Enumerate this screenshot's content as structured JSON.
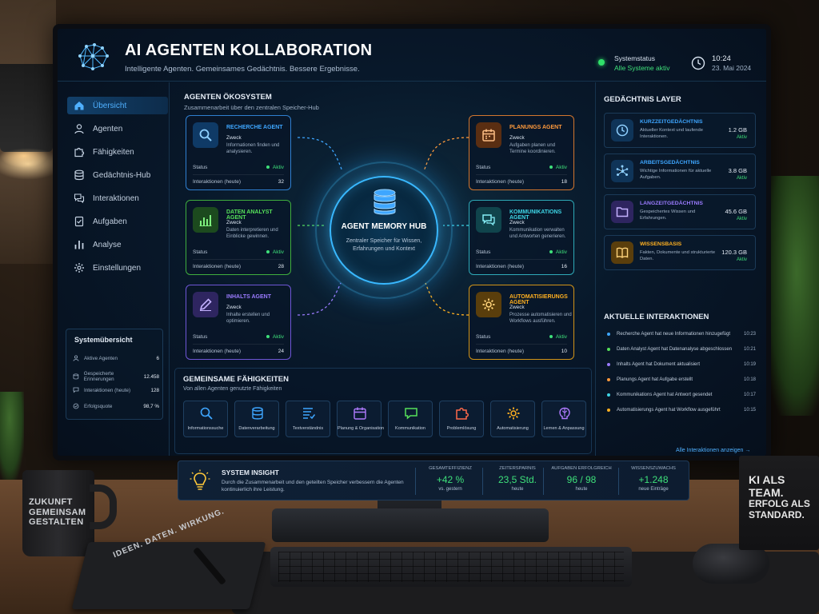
{
  "header": {
    "title": "AI AGENTEN KOLLABORATION",
    "subtitle": "Intelligente Agenten. Gemeinsames Gedächtnis. Bessere Ergebnisse.",
    "status_label": "Systemstatus",
    "status_value": "Alle Systeme aktiv",
    "time": "10:24",
    "date": "23. Mai 2024"
  },
  "sidebar": {
    "items": [
      {
        "label": "Übersicht",
        "icon": "home-icon",
        "active": true
      },
      {
        "label": "Agenten",
        "icon": "user-icon"
      },
      {
        "label": "Fähigkeiten",
        "icon": "puzzle-icon"
      },
      {
        "label": "Gedächtnis-Hub",
        "icon": "database-icon"
      },
      {
        "label": "Interaktionen",
        "icon": "chat-icon"
      },
      {
        "label": "Aufgaben",
        "icon": "tasks-icon"
      },
      {
        "label": "Analyse",
        "icon": "bar-chart-icon"
      },
      {
        "label": "Einstellungen",
        "icon": "gear-icon"
      }
    ],
    "overview": {
      "title": "Systemübersicht",
      "rows": [
        {
          "label": "Aktive Agenten",
          "value": "6"
        },
        {
          "label": "Gespeicherte Erinnerungen",
          "value": "12.458"
        },
        {
          "label": "Interaktionen (heute)",
          "value": "128"
        },
        {
          "label": "Erfolgsquote",
          "value": "98,7 %"
        }
      ]
    }
  },
  "ecosystem": {
    "title": "AGENTEN ÖKOSYSTEM",
    "subtitle": "Zusammenarbeit über den zentralen Speicher-Hub",
    "status_label": "Status",
    "interactions_label": "Interaktionen (heute)",
    "purpose_label": "Zweck",
    "active_label": "Aktiv",
    "agents": [
      {
        "name": "RECHERCHE AGENT",
        "desc": "Informationen finden und analysieren.",
        "count": "32",
        "color": "#3ea6ff"
      },
      {
        "name": "DATEN ANALYST AGENT",
        "desc": "Daten interpretieren und Einblicke gewinnen.",
        "count": "28",
        "color": "#56e05a"
      },
      {
        "name": "INHALTS AGENT",
        "desc": "Inhalte erstellen und optimieren.",
        "count": "24",
        "color": "#9b7bff"
      },
      {
        "name": "PLANUNGS AGENT",
        "desc": "Aufgaben planen und Termine koordinieren.",
        "count": "18",
        "color": "#ff9a3c"
      },
      {
        "name": "KOMMUNIKATIONS AGENT",
        "desc": "Kommunikation verwalten und Antworten generieren.",
        "count": "16",
        "color": "#3ed6e6"
      },
      {
        "name": "AUTOMATISIERUNGS AGENT",
        "desc": "Prozesse automatisieren und Workflows ausführen.",
        "count": "10",
        "color": "#ffb020"
      }
    ],
    "hub": {
      "title": "AGENT MEMORY HUB",
      "desc": "Zentraler Speicher für Wissen, Erfahrungen und Kontext"
    }
  },
  "skills": {
    "title": "GEMEINSAME FÄHIGKEITEN",
    "subtitle": "Von allen Agenten genutzte Fähigkeiten",
    "items": [
      {
        "label": "Informationssuche",
        "icon": "search-icon",
        "color": "#3ea6ff"
      },
      {
        "label": "Datenverarbeitung",
        "icon": "database-icon",
        "color": "#3ea6ff"
      },
      {
        "label": "Textverständnis",
        "icon": "text-icon",
        "color": "#3ea6ff"
      },
      {
        "label": "Planung & Organisation",
        "icon": "calendar-icon",
        "color": "#b07bff"
      },
      {
        "label": "Kommunikation",
        "icon": "chat-icon",
        "color": "#56e05a"
      },
      {
        "label": "Problemlösung",
        "icon": "puzzle-icon",
        "color": "#ff6a4a"
      },
      {
        "label": "Automatisierung",
        "icon": "gear-icon",
        "color": "#ffb020"
      },
      {
        "label": "Lernen & Anpassung",
        "icon": "brain-icon",
        "color": "#b07bff"
      }
    ]
  },
  "memory": {
    "title": "GEDÄCHTNIS LAYER",
    "active_label": "Aktiv",
    "layers": [
      {
        "name": "KURZZEITGEDÄCHTNIS",
        "desc": "Aktueller Kontext und laufende Interaktionen.",
        "size": "1.2 GB",
        "color": "#3ea6ff",
        "icon": "clock-icon"
      },
      {
        "name": "ARBEITSGEDÄCHTNIS",
        "desc": "Wichtige Informationen für aktuelle Aufgaben.",
        "size": "3.8 GB",
        "color": "#3ea6ff",
        "icon": "network-icon"
      },
      {
        "name": "LANGZEITGEDÄCHTNIS",
        "desc": "Gespeichertes Wissen und Erfahrungen.",
        "size": "45.6 GB",
        "color": "#9b7bff",
        "icon": "folder-icon"
      },
      {
        "name": "WISSENSBASIS",
        "desc": "Fakten, Dokumente und strukturierte Daten.",
        "size": "120.3 GB",
        "color": "#ffb020",
        "icon": "book-icon"
      }
    ]
  },
  "interactions": {
    "title": "AKTUELLE INTERAKTIONEN",
    "link": "Alle Interaktionen anzeigen  →",
    "items": [
      {
        "text": "Recherche Agent hat neue Informationen hinzugefügt",
        "time": "10:23",
        "color": "#3ea6ff"
      },
      {
        "text": "Daten Analyst Agent hat Datenanalyse abgeschlossen",
        "time": "10:21",
        "color": "#56e05a"
      },
      {
        "text": "Inhalts Agent hat Dokument aktualisiert",
        "time": "10:19",
        "color": "#9b7bff"
      },
      {
        "text": "Planungs Agent hat Aufgabe erstellt",
        "time": "10:18",
        "color": "#ff9a3c"
      },
      {
        "text": "Kommunikations Agent hat Antwort gesendet",
        "time": "10:17",
        "color": "#3ed6e6"
      },
      {
        "text": "Automatisierungs Agent hat Workflow ausgeführt",
        "time": "10:15",
        "color": "#ffb020"
      }
    ]
  },
  "insight": {
    "title": "SYSTEM INSIGHT",
    "desc": "Durch die Zusammenarbeit und den geteilten Speicher verbessern die Agenten kontinuierlich ihre Leistung.",
    "metrics": [
      {
        "label": "GESAMTEFFIZIENZ",
        "value": "+42 %",
        "sub": "vs. gestern"
      },
      {
        "label": "ZEITERSPARNIS",
        "value": "23,5 Std.",
        "sub": "heute"
      },
      {
        "label": "AUFGABEN ERFOLGREICH",
        "value": "96 / 98",
        "sub": "heute"
      },
      {
        "label": "WISSENSZUWACHS",
        "value": "+1.248",
        "sub": "neue Einträge"
      }
    ]
  },
  "props": {
    "mug_text": "ZUKUNFT GEMEINSAM GESTALTEN",
    "notebook_text": "IDEEN. DATEN. WIRKUNG.",
    "plaque_line1": "KI ALS TEAM.",
    "plaque_line2": "ERFOLG ALS STANDARD."
  }
}
